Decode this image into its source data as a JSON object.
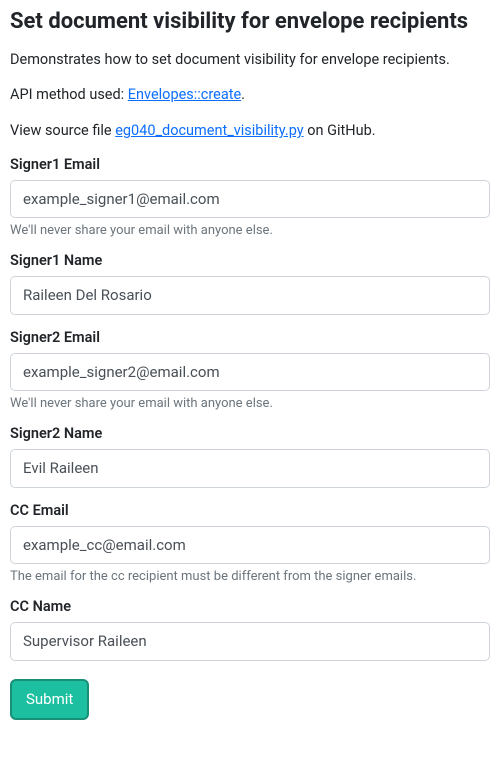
{
  "heading": "Set document visibility for envelope recipients",
  "intro": "Demonstrates how to set document visibility for envelope recipients.",
  "api_line_prefix": "API method used: ",
  "api_link_text": "Envelopes::create",
  "api_line_suffix": ".",
  "source_line_prefix": "View source file ",
  "source_link_text": "eg040_document_visibility.py",
  "source_line_suffix": " on GitHub.",
  "form": {
    "signer1_email": {
      "label": "Signer1 Email",
      "value": "example_signer1@email.com",
      "help": "We'll never share your email with anyone else."
    },
    "signer1_name": {
      "label": "Signer1 Name",
      "value": "Raileen Del Rosario"
    },
    "signer2_email": {
      "label": "Signer2 Email",
      "value": "example_signer2@email.com",
      "help": "We'll never share your email with anyone else."
    },
    "signer2_name": {
      "label": "Signer2 Name",
      "value": "Evil Raileen"
    },
    "cc_email": {
      "label": "CC Email",
      "value": "example_cc@email.com",
      "help": "The email for the cc recipient must be different from the signer emails."
    },
    "cc_name": {
      "label": "CC Name",
      "value": "Supervisor Raileen"
    },
    "submit_label": "Submit"
  }
}
